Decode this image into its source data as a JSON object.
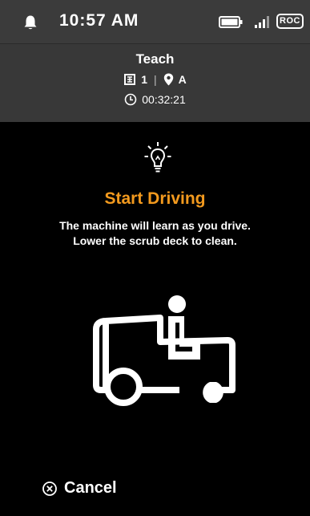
{
  "status_bar": {
    "time": "10:57 AM",
    "badge": "ROC",
    "icons": [
      "bell-icon",
      "battery-icon",
      "signal-icon"
    ]
  },
  "header": {
    "title": "Teach",
    "map_number": "1",
    "separator": "|",
    "location": "A",
    "elapsed": "00:32:21",
    "icons": [
      "map-icon",
      "location-pin-icon",
      "clock-icon"
    ]
  },
  "main": {
    "heading": "Start Driving",
    "line1": "The machine will learn as you drive.",
    "line2": "Lower the scrub deck to clean.",
    "icons": [
      "lightbulb-icon",
      "vehicle-driver-icon"
    ]
  },
  "footer": {
    "cancel_label": "Cancel",
    "icon": "cancel-circle-x-icon"
  },
  "colors": {
    "accent": "#f39a1e",
    "background": "#000000",
    "header_bg": "#383838"
  }
}
